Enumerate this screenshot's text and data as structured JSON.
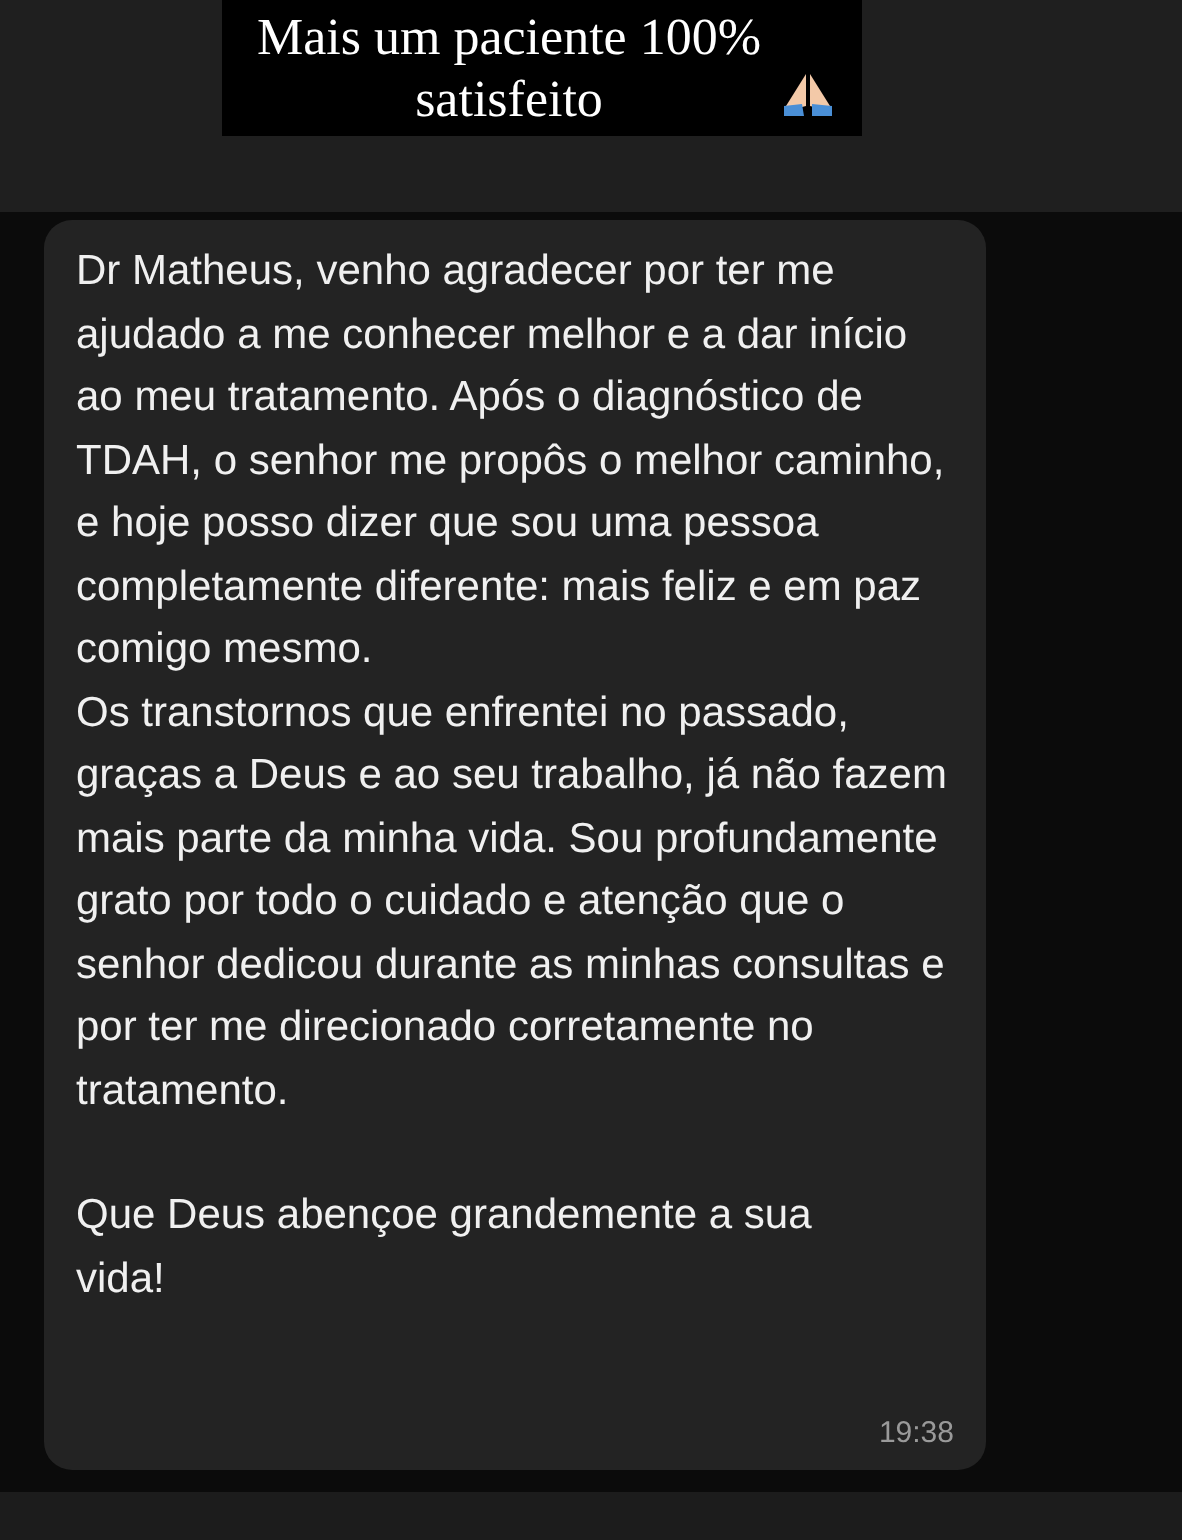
{
  "caption": {
    "text": "Mais um paciente 100% satisfeito"
  },
  "message": {
    "paragraphs": [
      "Dr Matheus, venho agradecer por ter me ajudado a me conhecer melhor e a dar início ao meu tratamento. Após o diagnóstico de TDAH, o senhor me propôs o melhor caminho, e hoje posso dizer que sou uma pessoa completamente diferente: mais feliz e em paz comigo mesmo.",
      "Os transtornos que enfrentei no passado, graças a Deus e ao seu trabalho, já não fazem mais parte da minha vida. Sou profundamente grato por todo o cuidado e atenção que o senhor dedicou durante as minhas consultas e por ter me direcionado corretamente no tratamento.",
      "Que Deus abençoe grandemente a sua vida!"
    ],
    "time": "19:38"
  }
}
